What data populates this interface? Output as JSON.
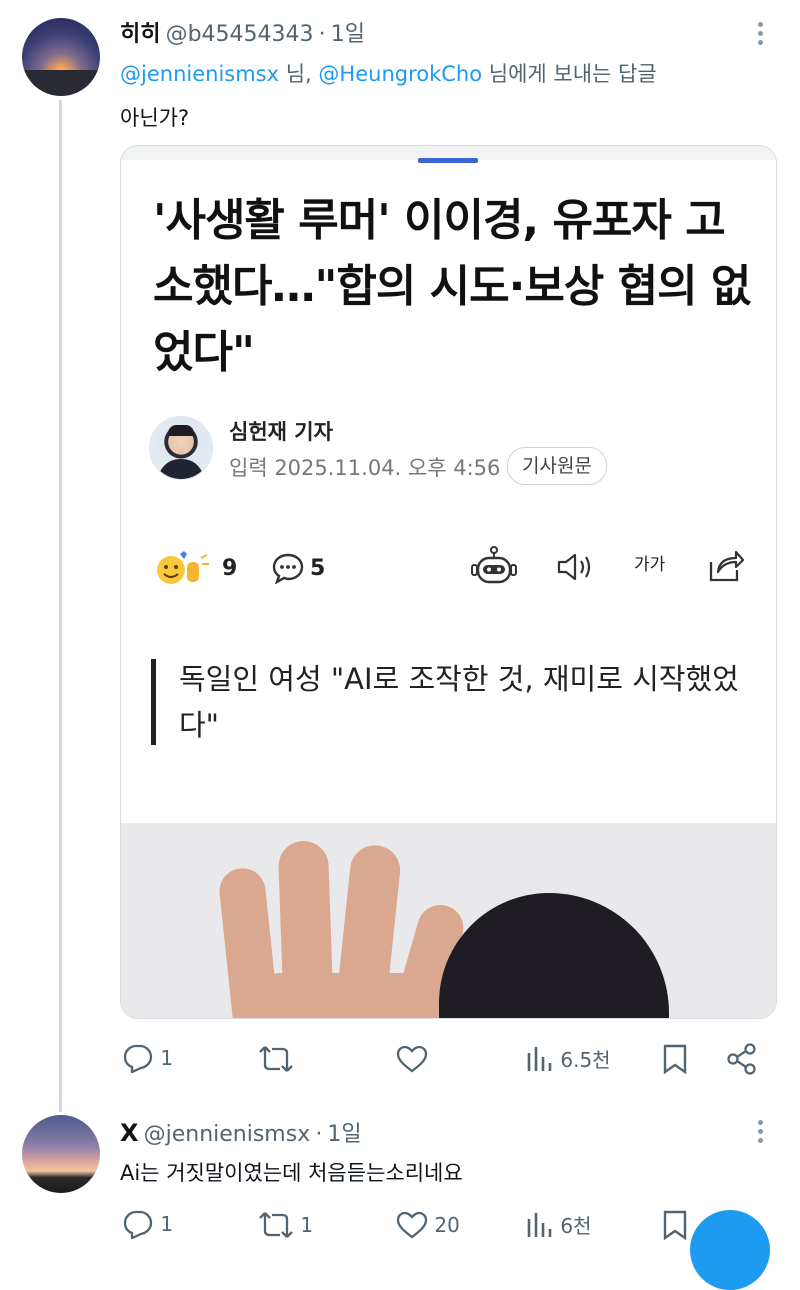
{
  "reply1": {
    "display_name": "히히",
    "handle": "@b45454343",
    "separator": "·",
    "time": "1일",
    "mention1": "@jennienismsx",
    "word_nim": "님,",
    "mention2": "@HeungrokCho",
    "text_tail": "님에게 보내는 답글",
    "body": "아닌가?"
  },
  "article": {
    "headline": "'사생활 루머' 이이경, 유포자 고소했다…\"합의 시도·보상 협의 없었다\"",
    "reporter": "심헌재 기자",
    "published": "입력 2025.11.04. 오후 4:56",
    "source_button": "기사원문",
    "reaction_count": "9",
    "comment_count": "5",
    "font_size_label": "가가",
    "subheadline": "독일인 여성 \"AI로 조작한 것, 재미로 시작했었다\""
  },
  "reply1_actions": {
    "replies": "1",
    "reposts": "",
    "likes": "",
    "views": "6.5천"
  },
  "reply2": {
    "display_name": "X",
    "handle": "@jennienismsx",
    "separator": "·",
    "time": "1일",
    "body": "Ai는 거짓말이였는데 처음듣는소리네요"
  },
  "reply2_actions": {
    "replies": "1",
    "reposts": "1",
    "likes": "20",
    "views": "6천"
  },
  "colors": {
    "link": "#1d9bf0",
    "muted": "#536471",
    "divider": "#cfd9de",
    "card_indicator": "#3b66d6"
  }
}
